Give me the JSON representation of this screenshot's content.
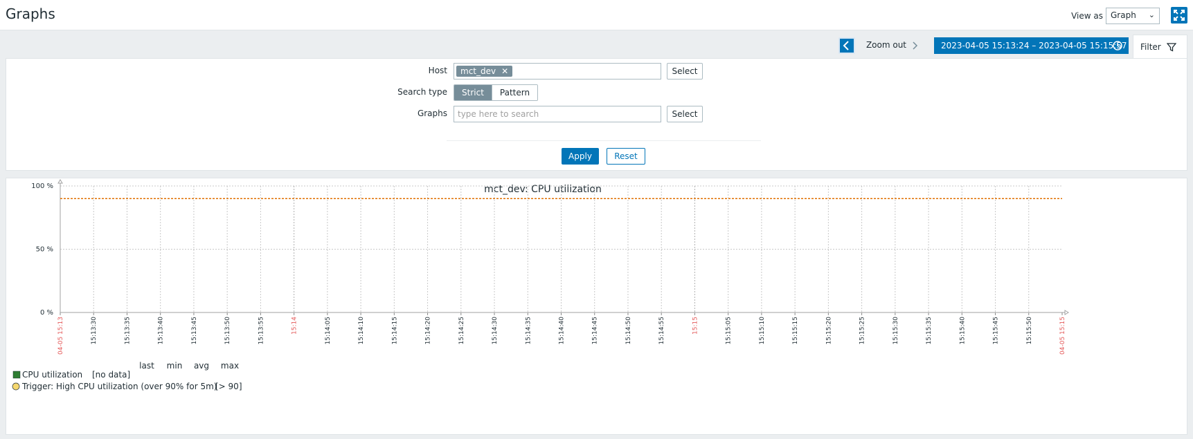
{
  "header": {
    "title": "Graphs",
    "view_as_label": "View as",
    "view_as_value": "Graph"
  },
  "timebar": {
    "zoom_out_label": "Zoom out",
    "range": "2023-04-05 15:13:24 – 2023-04-05 15:15:57",
    "filter_tab_label": "Filter"
  },
  "filter": {
    "host_label": "Host",
    "host_chip": "mct_dev",
    "host_select_label": "Select",
    "search_type_label": "Search type",
    "search_type_options": [
      "Strict",
      "Pattern"
    ],
    "search_type_selected": "Strict",
    "graphs_label": "Graphs",
    "graphs_placeholder": "type here to search",
    "graphs_select_label": "Select",
    "apply_label": "Apply",
    "reset_label": "Reset"
  },
  "colors": {
    "accent": "#0275b8",
    "trigger_line": "#e07000",
    "series_green": "#2e7d32",
    "trigger_yellow": "#f5d76e",
    "time_red": "#e45959"
  },
  "chart_data": {
    "type": "line",
    "title": "mct_dev: CPU utilization",
    "y_ticks": [
      "100 %",
      "50 %",
      "0 %"
    ],
    "ylim": [
      0,
      100
    ],
    "x_tick_labels": [
      {
        "text": "04-05 15:13",
        "red": true
      },
      {
        "text": "15:13:30",
        "red": false
      },
      {
        "text": "15:13:35",
        "red": false
      },
      {
        "text": "15:13:40",
        "red": false
      },
      {
        "text": "15:13:45",
        "red": false
      },
      {
        "text": "15:13:50",
        "red": false
      },
      {
        "text": "15:13:55",
        "red": false
      },
      {
        "text": "15:14",
        "red": true
      },
      {
        "text": "15:14:05",
        "red": false
      },
      {
        "text": "15:14:10",
        "red": false
      },
      {
        "text": "15:14:15",
        "red": false
      },
      {
        "text": "15:14:20",
        "red": false
      },
      {
        "text": "15:14:25",
        "red": false
      },
      {
        "text": "15:14:30",
        "red": false
      },
      {
        "text": "15:14:35",
        "red": false
      },
      {
        "text": "15:14:40",
        "red": false
      },
      {
        "text": "15:14:45",
        "red": false
      },
      {
        "text": "15:14:50",
        "red": false
      },
      {
        "text": "15:14:55",
        "red": false
      },
      {
        "text": "15:15",
        "red": true
      },
      {
        "text": "15:15:05",
        "red": false
      },
      {
        "text": "15:15:10",
        "red": false
      },
      {
        "text": "15:15:15",
        "red": false
      },
      {
        "text": "15:15:20",
        "red": false
      },
      {
        "text": "15:15:25",
        "red": false
      },
      {
        "text": "15:15:30",
        "red": false
      },
      {
        "text": "15:15:35",
        "red": false
      },
      {
        "text": "15:15:40",
        "red": false
      },
      {
        "text": "15:15:45",
        "red": false
      },
      {
        "text": "15:15:50",
        "red": false
      },
      {
        "text": "04-05 15:15",
        "red": true
      }
    ],
    "trigger_threshold": 90,
    "grid": true,
    "legend_columns": [
      "last",
      "min",
      "avg",
      "max"
    ],
    "legend": [
      {
        "name": "CPU utilization",
        "value": "[no data]",
        "swatch": "square"
      },
      {
        "name": "Trigger: High CPU utilization (over 90% for 5m)",
        "value": "[> 90]",
        "swatch": "circle"
      }
    ]
  }
}
